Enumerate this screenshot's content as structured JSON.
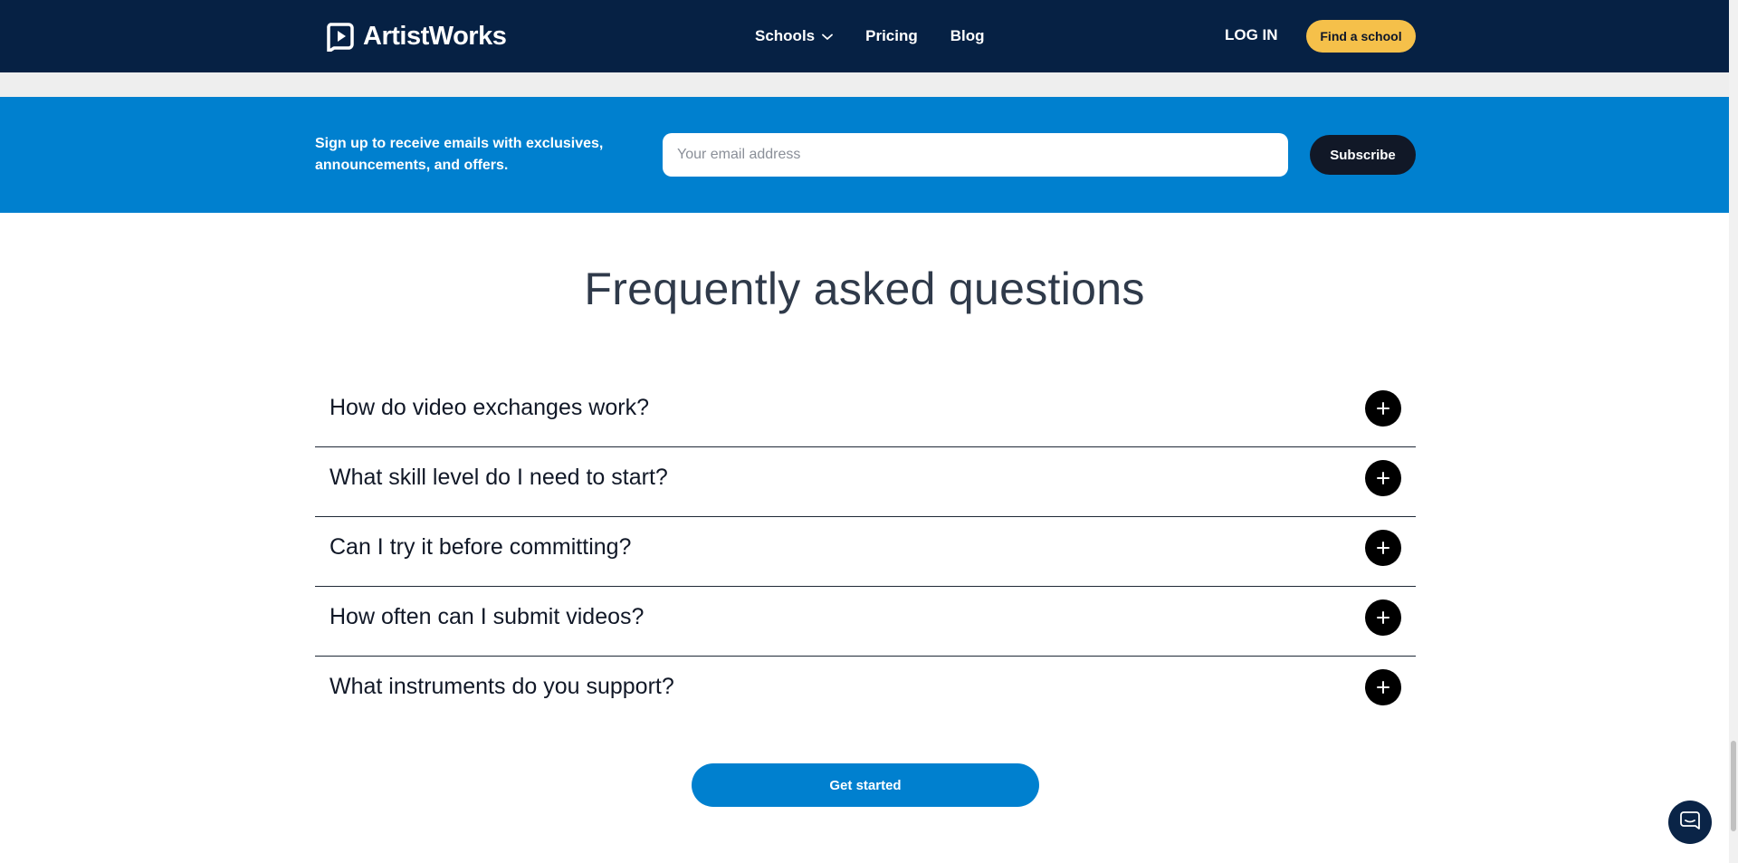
{
  "header": {
    "logo_text": "ArtistWorks",
    "nav": [
      {
        "label": "Schools",
        "has_dropdown": true
      },
      {
        "label": "Pricing"
      },
      {
        "label": "Blog"
      }
    ],
    "login_label": "LOG IN",
    "cta_label": "Find a school"
  },
  "newsletter": {
    "text": "Sign up to receive emails with exclusives, announcements, and offers.",
    "email_placeholder": "Your email address",
    "email_value": "",
    "subscribe_label": "Subscribe"
  },
  "faq": {
    "title": "Frequently asked questions",
    "items": [
      {
        "question": "How do video exchanges work?",
        "icon": "plus-icon"
      },
      {
        "question": "What skill level do I need to start?",
        "icon": "plus-icon"
      },
      {
        "question": "Can I try it before committing?",
        "icon": "plus-icon"
      },
      {
        "question": "How often can I submit videos?",
        "icon": "plus-icon"
      },
      {
        "question": "What instruments do you support?",
        "icon": "plus-icon"
      }
    ],
    "cta_label": "Get started"
  },
  "colors": {
    "header_bg": "#062144",
    "newsletter_bg": "#0080cf",
    "accent_yellow": "#f5c04a",
    "dark_button": "#111827",
    "primary_blue": "#0080cf"
  },
  "icons": {
    "logo": "play-logo-icon",
    "schools_dropdown": "chevron-down-icon",
    "chat": "chat-bubble-icon"
  }
}
